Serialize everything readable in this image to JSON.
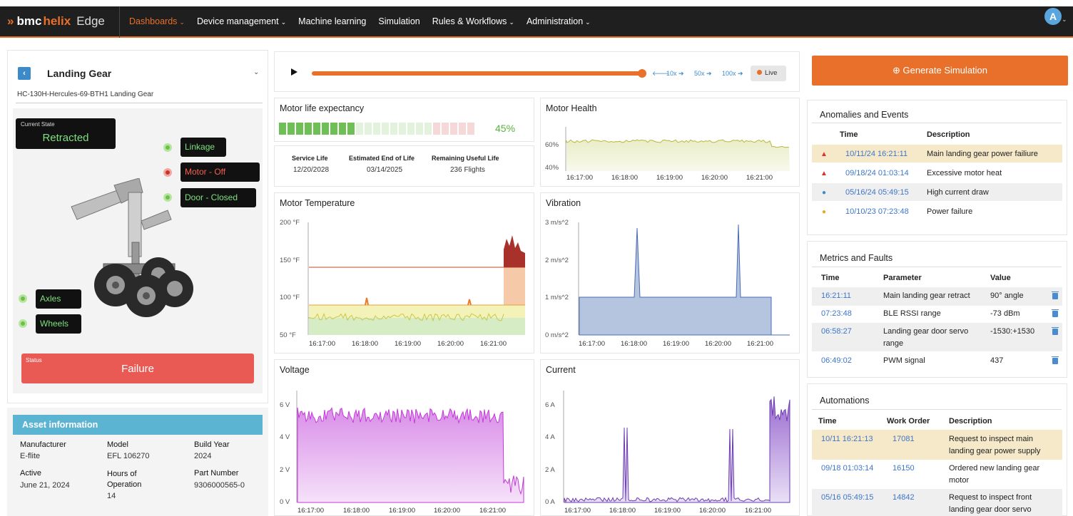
{
  "app": {
    "brand_bmc": "bmc",
    "brand_helix": "helix",
    "brand_product": "Edge"
  },
  "nav": [
    {
      "label": "Dashboards",
      "caret": "⌄",
      "active": true
    },
    {
      "label": "Device management",
      "caret": "⌄"
    },
    {
      "label": "Machine learning",
      "caret": ""
    },
    {
      "label": "Simulation",
      "caret": ""
    },
    {
      "label": "Rules & Workflows",
      "caret": "⌄"
    },
    {
      "label": "Administration",
      "caret": "⌄"
    }
  ],
  "user": {
    "avatar_initial": "A"
  },
  "asset_panel": {
    "title": "Landing Gear",
    "subtitle": "HC-130H-Hercules-69-BTH1 Landing Gear",
    "current_state_label": "Current State",
    "current_state_value": "Retracted",
    "components": {
      "linkage": "Linkage",
      "motor": "Motor - Off",
      "door": "Door - Closed",
      "axles": "Axles",
      "wheels": "Wheels"
    },
    "status_label": "Status",
    "status_value": "Failure"
  },
  "asset_info": {
    "title": "Asset information",
    "manufacturer_label": "Manufacturer",
    "manufacturer": "E-flite",
    "model_label": "Model",
    "model": "EFL 106270",
    "build_year_label": "Build Year",
    "build_year": "2024",
    "active_label": "Active",
    "active": "June 21, 2024",
    "hours_label": "Hours of Operation",
    "hours": "14",
    "part_label": "Part Number",
    "part": "9306000565-0"
  },
  "playback": {
    "progress": 1.0,
    "speeds": [
      "10x ➔",
      "50x ➔",
      "100x ➔"
    ],
    "back_arrow": "🡐",
    "live_label": "Live"
  },
  "motor_life": {
    "title": "Motor life expectancy",
    "percent_label": "45%",
    "percent": 45,
    "service_life_label": "Service Life",
    "service_life": "12/20/2028",
    "eol_label": "Estimated End of Life",
    "eol": "03/14/2025",
    "rul_label": "Remaining Useful Life",
    "rul": "236 Flights"
  },
  "time_ticks": [
    "16:17:00",
    "16:18:00",
    "16:19:00",
    "16:20:00",
    "16:21:00"
  ],
  "motor_health": {
    "title": "Motor Health",
    "y_ticks": [
      "60%",
      "40%"
    ]
  },
  "motor_temp": {
    "title": "Motor Temperature",
    "y_ticks": [
      "200 °F",
      "150 °F",
      "100 °F",
      "50 °F"
    ]
  },
  "vibration": {
    "title": "Vibration",
    "y_ticks": [
      "3 m/s^2",
      "2 m/s^2",
      "1 m/s^2",
      "0 m/s^2"
    ]
  },
  "voltage": {
    "title": "Voltage",
    "y_ticks": [
      "6 V",
      "4 V",
      "2 V",
      "0 V"
    ]
  },
  "current": {
    "title": "Current",
    "y_ticks": [
      "6 A",
      "4 A",
      "2 A",
      "0 A"
    ]
  },
  "generate": {
    "icon": "⊕",
    "label": "Generate Simulation"
  },
  "anomalies": {
    "title": "Anomalies and Events",
    "col_time": "Time",
    "col_desc": "Description",
    "rows": [
      {
        "icon": "▲",
        "color": "#d9342b",
        "time": "10/11/24 16:21:11",
        "desc": "Main landing gear power failiure"
      },
      {
        "icon": "▲",
        "color": "#d9342b",
        "time": "09/18/24 01:03:14",
        "desc": "Excessive motor heat"
      },
      {
        "icon": "●",
        "color": "#3d8ac9",
        "time": "05/16/24 05:49:15",
        "desc": "High current draw"
      },
      {
        "icon": "●",
        "color": "#e9a81c",
        "time": "10/10/23 07:23:48",
        "desc": "Power failure"
      }
    ]
  },
  "metrics": {
    "title": "Metrics and Faults",
    "col_time": "Time",
    "col_param": "Parameter",
    "col_value": "Value",
    "rows": [
      {
        "time": "16:21:11",
        "param": "Main landing gear retract",
        "value": "90° angle"
      },
      {
        "time": "07:23:48",
        "param": "BLE RSSI range",
        "value": "-73 dBm"
      },
      {
        "time": "06:58:27",
        "param": "Landing gear door servo range",
        "value": "-1530:+1530"
      },
      {
        "time": "06:49:02",
        "param": "PWM signal",
        "value": "437"
      }
    ]
  },
  "automations": {
    "title": "Automations",
    "col_time": "Time",
    "col_wo": "Work Order",
    "col_desc": "Description",
    "rows": [
      {
        "time": "10/11 16:21:13",
        "wo": "17081",
        "desc": "Request to inspect main landing gear power supply"
      },
      {
        "time": "09/18 01:03:14",
        "wo": "16150",
        "desc": "Ordered new landing gear motor"
      },
      {
        "time": "05/16 05:49:15",
        "wo": "14842",
        "desc": "Request to inspect front landing gear door servo"
      }
    ]
  },
  "colors": {
    "accent": "#e8702a",
    "link": "#3d76c9",
    "ok": "#7ee07e",
    "fail": "#ea5a55"
  }
}
